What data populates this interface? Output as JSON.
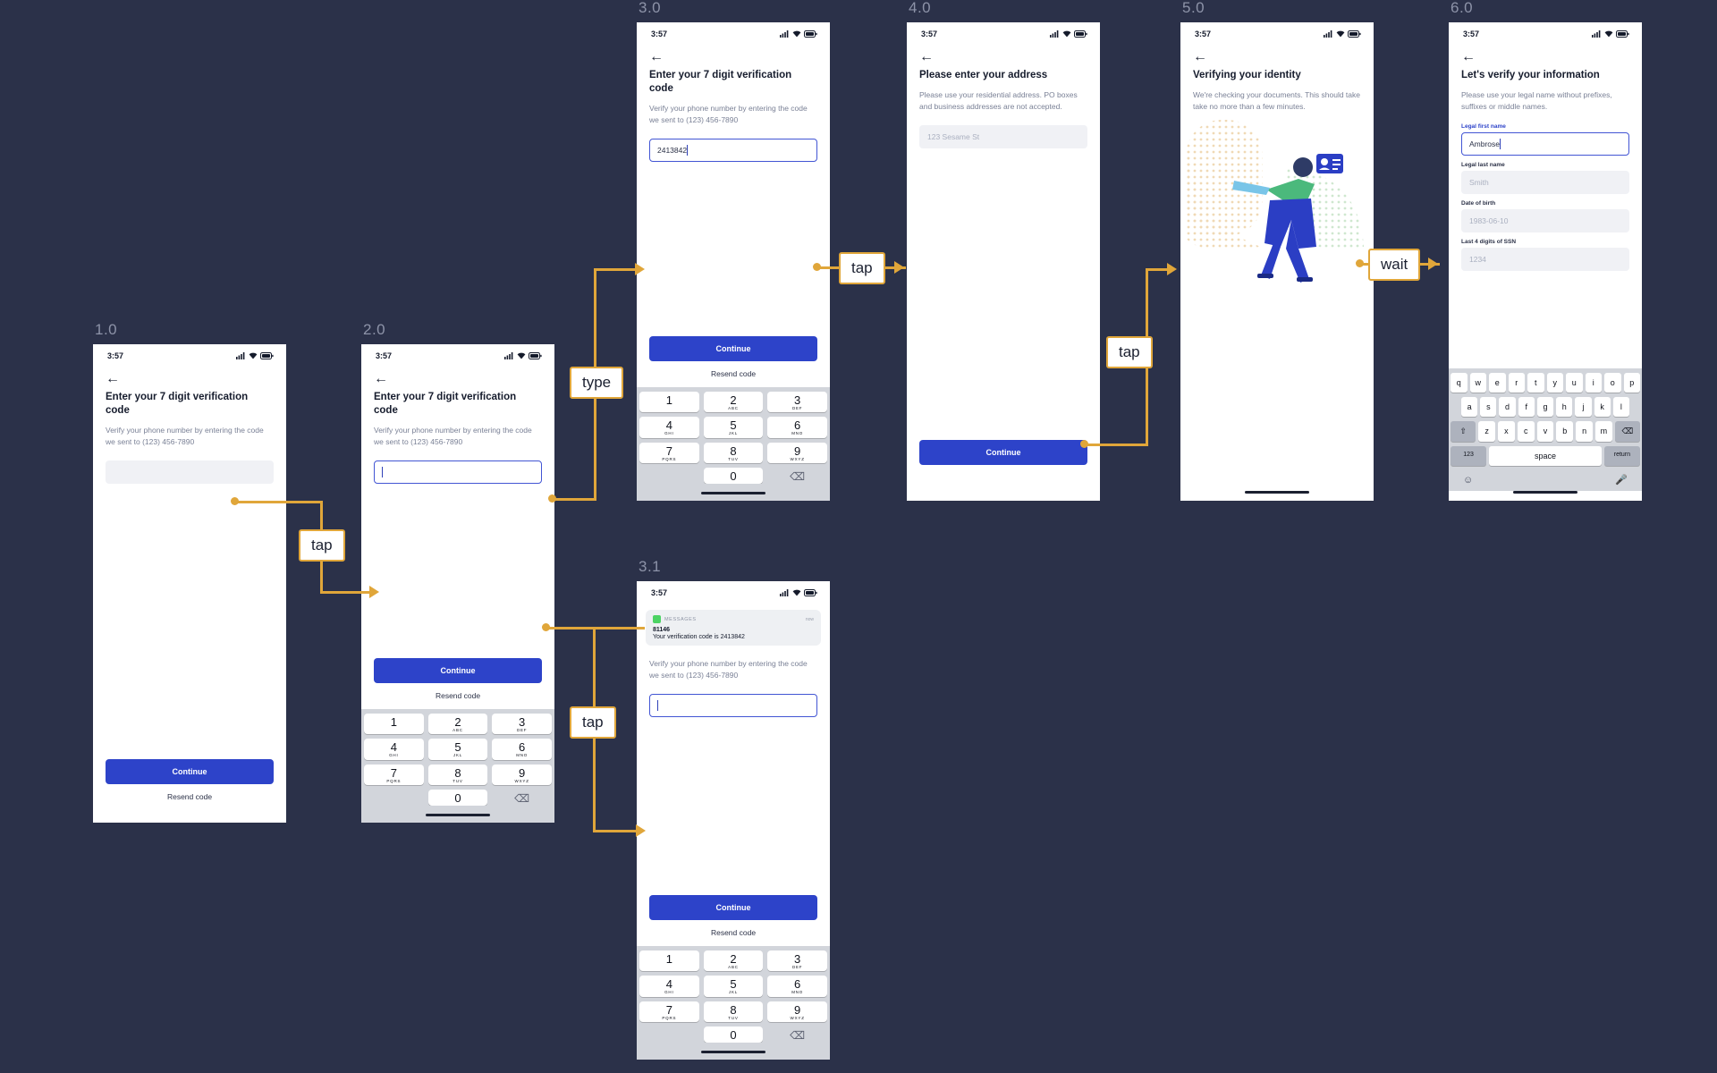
{
  "canvas": {
    "background": "#2b3149",
    "accent": "#e0a63a",
    "primary": "#2d43c9"
  },
  "flow_labels": [
    {
      "id": "l1",
      "text": "tap"
    },
    {
      "id": "l2",
      "text": "type"
    },
    {
      "id": "l3",
      "text": "tap"
    },
    {
      "id": "l4",
      "text": "tap"
    },
    {
      "id": "l5",
      "text": "tap"
    },
    {
      "id": "l6",
      "text": "tap"
    },
    {
      "id": "l7",
      "text": "wait"
    }
  ],
  "screens": {
    "s10": {
      "id": "1.0",
      "status_time": "3:57",
      "back_icon": "back-arrow-icon",
      "title": "Enter your 7 digit verification code",
      "subtitle": "Verify your phone number by entering the code we sent to (123) 456-7890",
      "input_placeholder": "",
      "input_value": "",
      "cta": "Continue",
      "resend": "Resend code"
    },
    "s20": {
      "id": "2.0",
      "status_time": "3:57",
      "title": "Enter your 7 digit verification code",
      "subtitle": "Verify your phone number by entering the code we sent to (123) 456-7890",
      "input_value": "",
      "cta": "Continue",
      "resend": "Resend code"
    },
    "s30": {
      "id": "3.0",
      "status_time": "3:57",
      "title": "Enter your 7 digit verification code",
      "subtitle": "Verify your phone number by entering the code we sent to (123) 456-7890",
      "input_value": "2413842",
      "cta": "Continue",
      "resend": "Resend code"
    },
    "s31": {
      "id": "3.1",
      "status_time": "3:57",
      "notification": {
        "app": "MESSAGES",
        "time": "now",
        "title": "81146",
        "body": "Your verification code is 2413842"
      },
      "subtitle": "Verify your phone number by entering the code we sent to (123) 456-7890",
      "input_value": "",
      "cta": "Continue",
      "resend": "Resend code"
    },
    "s40": {
      "id": "4.0",
      "status_time": "3:57",
      "title": "Please enter your address",
      "subtitle": "Please use your residential address. PO boxes and business addresses are not accepted.",
      "input_placeholder": "123 Sesame St",
      "cta": "Continue"
    },
    "s50": {
      "id": "5.0",
      "status_time": "3:57",
      "title": "Verifying your identity",
      "subtitle": "We're checking your documents. This should take take no more than a few minutes.",
      "illustration": "identity-verification-illustration"
    },
    "s60": {
      "id": "6.0",
      "status_time": "3:57",
      "title": "Let's verify your information",
      "subtitle": "Please use your legal name without prefixes, suffixes or middle names.",
      "fields": [
        {
          "label": "Legal first name",
          "value": "Ambrose",
          "focused": true
        },
        {
          "label": "Legal last name",
          "value": "Smith",
          "focused": false
        },
        {
          "label": "Date of birth",
          "value": "1983-06-10",
          "focused": false
        },
        {
          "label": "Last 4 digits of SSN",
          "value": "1234",
          "focused": false
        }
      ]
    }
  },
  "keypad": {
    "keys": [
      {
        "num": "1",
        "sub": ""
      },
      {
        "num": "2",
        "sub": "ABC"
      },
      {
        "num": "3",
        "sub": "DEF"
      },
      {
        "num": "4",
        "sub": "GHI"
      },
      {
        "num": "5",
        "sub": "JKL"
      },
      {
        "num": "6",
        "sub": "MNO"
      },
      {
        "num": "7",
        "sub": "PQRS"
      },
      {
        "num": "8",
        "sub": "TUV"
      },
      {
        "num": "9",
        "sub": "WXYZ"
      },
      {
        "num": "",
        "sub": ""
      },
      {
        "num": "0",
        "sub": ""
      },
      {
        "num": "⌫",
        "sub": ""
      }
    ]
  },
  "keyboard": {
    "row1": [
      "q",
      "w",
      "e",
      "r",
      "t",
      "y",
      "u",
      "i",
      "o",
      "p"
    ],
    "row2": [
      "a",
      "s",
      "d",
      "f",
      "g",
      "h",
      "j",
      "k",
      "l"
    ],
    "row3": [
      "⇧",
      "z",
      "x",
      "c",
      "v",
      "b",
      "n",
      "m",
      "⌫"
    ],
    "row4": [
      "123",
      "space",
      "return"
    ],
    "emoji_icon": "emoji-icon",
    "mic_icon": "microphone-icon"
  }
}
